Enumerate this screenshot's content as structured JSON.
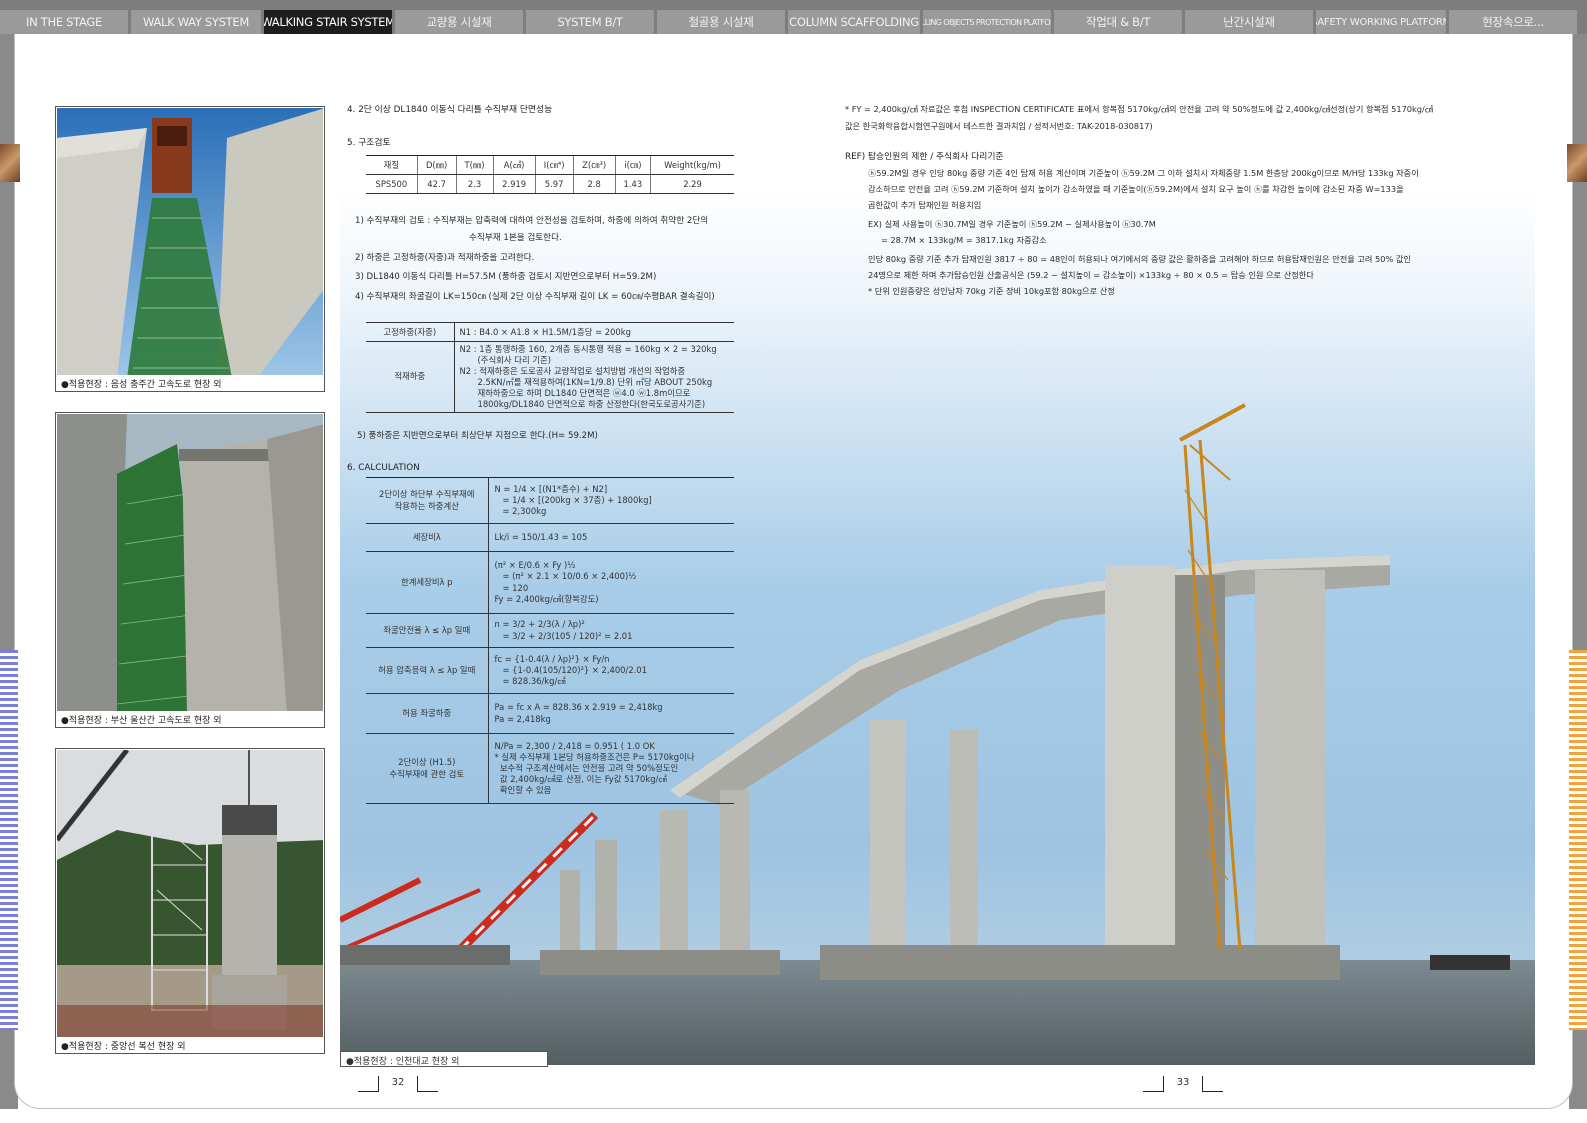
{
  "tabs": [
    {
      "label": "IN THE STAGE",
      "active": false
    },
    {
      "label": "WALK WAY SYSTEM",
      "active": false
    },
    {
      "label": "WALKING STAIR SYSTEM",
      "active": true
    },
    {
      "label": "교량용 시설재",
      "active": false
    },
    {
      "label": "SYSTEM B/T",
      "active": false
    },
    {
      "label": "철골용 시설재",
      "active": false
    },
    {
      "label": "COLUMN SCAFFOLDING",
      "active": false
    },
    {
      "label": "FALLING OBJECTS PROTECTION PLATFORM",
      "active": false
    },
    {
      "label": "작업대 & B/T",
      "active": false
    },
    {
      "label": "난간시설재",
      "active": false
    },
    {
      "label": "SAFETY WORKING PLATFORM",
      "active": false
    },
    {
      "label": "현장속으로...",
      "active": false
    }
  ],
  "photos": {
    "cap1": "●적용현장 : 음성 충주간 고속도로 현장 외",
    "cap2": "●적용현장 : 부산 울산간 고속도로 현장 외",
    "cap3": "●적용현장 : 중앙선 복선 현장 외",
    "cap4": "●적용현장 : 인천대교 현장 외"
  },
  "left": {
    "section4": "4. 2단 이상  DL1840 이동식 다리틀 수직부재 단면성능",
    "section5": "5. 구조검토",
    "spec_header": [
      "재질",
      "D(㎜)",
      "T(㎜)",
      "A(㎠)",
      "I(㎝⁴)",
      "Z(㎝³)",
      "i(㎝)",
      "Weight(kg/m)"
    ],
    "spec_row": [
      "SPS500",
      "42.7",
      "2.3",
      "2.919",
      "5.97",
      "2.8",
      "1.43",
      "2.29"
    ],
    "notes": [
      "1) 수직부재의 검토 : 수직부재는 압축력에 대하여 안전성을 검토하며, 하중에 의하여 취약한 2단의",
      "수직부재 1본을 검토한다.",
      "2) 하중은 고정하중(자중)과 적재하중을 고려한다.",
      "3) DL1840 이동식 다리틀 H=57.5M (풍하중 검토시 지반면으로부터 H=59.2M)",
      "4) 수직부재의 좌굴길이 LK=150㎝ (실제 2단 이상 수직부재 길이 LK = 60㎝/수평BAR 결속길이)"
    ],
    "load_fixed_label": "고정하중(자중)",
    "load_fixed_value": "N1 : B4.0 × A1.8 × H1.5M/1층당 = 200kg",
    "load_live_label": "적재하중",
    "load_live_lines": [
      "N2 : 1층 통행하중 160, 2개층 동시통행 적용 = 160kg × 2 = 320kg",
      "(주식회사 다리 기준)",
      "N2 : 적재하중은 도로공사 교량작업로 설치방법 개선의 작업하중",
      "2.5KN/㎡를 재적용하여(1KN=1/9.8) 단위 ㎡당 ABOUT 250kg",
      "재하하중으로 하며 DL1840 단면적은 ⓦ4.0 ⓦ1.8m이므로",
      "1800kg/DL1840 단면적으로 하중 산정한다(한국도로공사기준)"
    ],
    "note5": "5) 풍하중은 지반면으로부터 최상단부 지점으로 한다.(H= 59.2M)",
    "section6": "6. CALCULATION",
    "calc": [
      {
        "label": "2단이상 하단부 수직부재에\n작용하는 하중계산",
        "lines": [
          "N = 1/4 × [(N1*층수) + N2]",
          "   = 1/4 × [(200kg × 37층) + 1800kg]",
          "   = 2,300kg"
        ]
      },
      {
        "label": "세장비λ",
        "lines": [
          "Lk/i = 150/1.43 = 105"
        ]
      },
      {
        "label": "한계세장비λ p",
        "lines": [
          "(π² × E/0.6 × Fy )½",
          "   = (π² × 2.1 × 10/0.6 × 2,400)½",
          "   = 120",
          "Fy = 2,400kg/㎠(항복강도)"
        ]
      },
      {
        "label": "좌굴안전율 λ ≤ λp 일때",
        "lines": [
          "n = 3/2 + 2/3(λ / λp)²",
          "   = 3/2 + 2/3(105 / 120)² = 2.01"
        ]
      },
      {
        "label": "허용 압축응력 λ ≤ λp 일때",
        "lines": [
          "fc = {1-0.4(λ / λp)²} × Fy/n",
          "   = {1-0.4(105/120)²} × 2,400/2.01",
          "   = 828.36/kg/㎠"
        ]
      },
      {
        "label": "허용 좌굴하중",
        "lines": [
          "Pa = fc x A = 828.36 x 2.919 = 2,418kg",
          "Pa = 2,418kg"
        ]
      },
      {
        "label": "2단이상 (H1.5)\n수직부재에 관한 검토",
        "lines": [
          "N/Pa = 2,300 / 2,418 = 0.951 ( 1.0 OK",
          "* 실제 수직부재 1본당 허용하중조건은 P= 5170kg이나",
          "  보수적 구조계산에서는 안전을 고려 약 50%정도인",
          "  값 2,400kg/㎠로 산정, 이는 Fy값 5170kg/㎠",
          "  확인할 수 있음"
        ]
      }
    ]
  },
  "right": {
    "fy_note": [
      "* FY = 2,400kg/㎠ 자료값은 후첨 INSPECTION CERTIFICATE 표에서 항복점 5170kg/㎠의 안전율 고려 약 50%정도에 값 2,400kg/㎠선정(상기 항복점 5170kg/㎠",
      "값은 한국화학융합시험연구원에서 테스트한 결과치임 / 성적서번호: TAK-2018-030817)"
    ],
    "ref_title": "REF) 탑승인원의 제한 / 주식회사 다리기준",
    "ref_lines": [
      "ⓗ59.2M일 경우 인당 80kg 중량 기준 4인 탑재 허용 계산이며 기준높이 ⓗ59.2M 그 이하 설치시 자체중량 1.5M 한층당 200kg이므로 M/H당 133kg 자중이",
      "감소하므로 안전율 고려 ⓗ59.2M 기준하여 설치 높이가 감소하였을 때 기준높이(ⓗ59.2M)에서 설치 요구 높이 ⓗ를 차감한 높이에 감소된 자중 W=133을",
      "곱한값이 추가 탑재인원 허용치임"
    ],
    "ex_lines": [
      "EX) 실제 사용높이 ⓗ30.7M일 경우 기준높이 ⓗ59.2M − 실제사용높이 ⓗ30.7M",
      "     = 28.7M × 133kg/M = 3817.1kg 자중감소"
    ],
    "person_lines": [
      "인당 80kg 중량 기준 추가 탑재인원 3817 ÷ 80 = 48인이 허용되나 여기에서의 중량 값은 활하중을 고려해야 하므로 허용탑재인원은 안전율 고려 50% 값인",
      "24명으로 제한 하며 추가탑승인원 산출공식은 (59.2 − 설치높이 = 감소높이) ×133kg ÷ 80 × 0.5 = 탑승 인원 으로 산정한다",
      "* 단위 인원중량은 성인남자 70kg 기준 장비 10kg포함 80kg으로 산정"
    ]
  },
  "page_numbers": {
    "left": "32",
    "right": "33"
  }
}
